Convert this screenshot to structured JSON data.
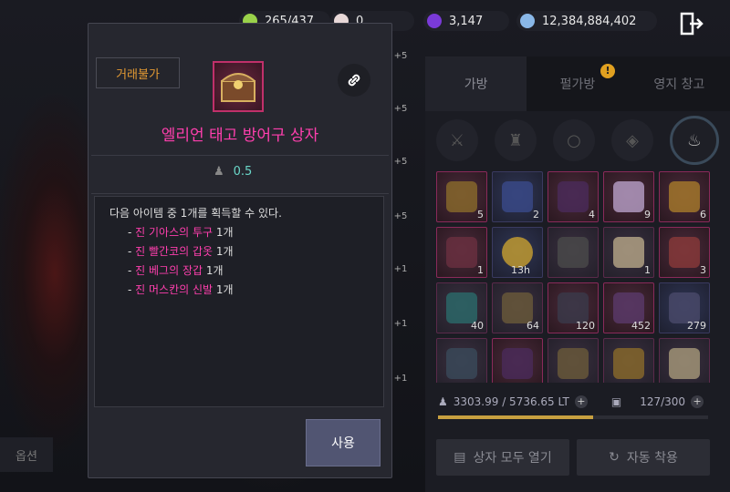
{
  "currencies": [
    {
      "value": "265/437",
      "color": "#9ad24a",
      "icon": "stamina-icon"
    },
    {
      "value": "0",
      "color": "#e8d8d8",
      "icon": "pearl-icon"
    },
    {
      "value": "3,147",
      "color": "#7a3ad8",
      "icon": "crystal-icon"
    },
    {
      "value": "12,384,884,402",
      "color": "#8ab8e8",
      "icon": "silver-icon"
    }
  ],
  "tabs": [
    "가방",
    "펄가방",
    "영지 창고"
  ],
  "tab_badge": "!",
  "inventory": {
    "quantities": [
      [
        "5",
        "2",
        "4",
        "9",
        "6"
      ],
      [
        "1",
        "",
        "",
        "1",
        "3"
      ],
      [
        "40",
        "64",
        "120",
        "452",
        "279"
      ],
      [
        "",
        "",
        "",
        "",
        ""
      ]
    ],
    "timer": "13h",
    "weight": "3303.99 / 5736.65 LT",
    "weight_fraction": 0.576,
    "slots": "127/300",
    "open_all_label": "상자 모두 열기",
    "auto_equip_label": "자동 착용"
  },
  "left": {
    "option_label": "옵션",
    "plus_badges": [
      "+5",
      "+5",
      "+5",
      "+5",
      "+1",
      "+1",
      "+1"
    ]
  },
  "modal": {
    "trade_tag": "거래불가",
    "item_name": "엘리언 태고 방어구 상자",
    "weight": "0.5",
    "description": "다음 아이템 중 1개를 획득할 수 있다.",
    "rewards": [
      {
        "name": "진 기아스의 투구",
        "qty": "1개"
      },
      {
        "name": "진 빨간코의 갑옷",
        "qty": "1개"
      },
      {
        "name": "진 베그의 장갑",
        "qty": "1개"
      },
      {
        "name": "진 머스칸의 신발",
        "qty": "1개"
      }
    ],
    "use_label": "사용"
  }
}
